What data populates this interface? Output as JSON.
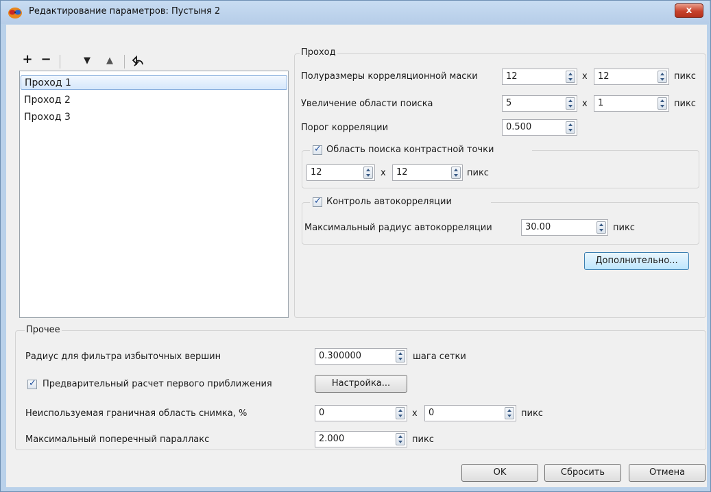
{
  "window": {
    "title": "Редактирование параметров: Пустыня 2",
    "close_label": "x"
  },
  "toolbar": {
    "add_label": "+",
    "remove_label": "−",
    "down_label": "▼",
    "up_label": "▲",
    "undo_icon": "undo-icon"
  },
  "passes": {
    "items": [
      "Проход 1",
      "Проход 2",
      "Проход 3"
    ],
    "selected_index": 0
  },
  "pass_group": {
    "title": "Проход",
    "mask_label": "Полуразмеры корреляционной маски",
    "mask_x": "12",
    "mask_sep": "x",
    "mask_y": "12",
    "mask_unit": "пикс",
    "search_label": "Увеличение области поиска",
    "search_x": "5",
    "search_sep": "x",
    "search_y": "1",
    "search_unit": "пикс",
    "threshold_label": "Порог корреляции",
    "threshold_value": "0.500",
    "contrast_group": {
      "title": "Область поиска контрастной точки",
      "checked": true,
      "x": "12",
      "sep": "x",
      "y": "12",
      "unit": "пикс"
    },
    "autocorr_group": {
      "title": "Контроль автокорреляции",
      "checked": true,
      "radius_label": "Максимальный радиус автокорреляции",
      "radius_value": "30.00",
      "unit": "пикс"
    },
    "advanced_button": "Дополнительно..."
  },
  "other_group": {
    "title": "Прочее",
    "filter_label": "Радиус для фильтра избыточных вершин",
    "filter_value": "0.300000",
    "filter_unit": "шага сетки",
    "precalc_label": "Предварительный расчет первого приближения",
    "precalc_checked": true,
    "setup_button": "Настройка...",
    "border_label": "Неиспользуемая граничная область снимка, %",
    "border_x": "0",
    "border_sep": "x",
    "border_y": "0",
    "border_unit": "пикс",
    "parallax_label": "Максимальный поперечный параллакс",
    "parallax_value": "2.000",
    "parallax_unit": "пикс"
  },
  "buttons": {
    "ok": "OK",
    "reset": "Сбросить",
    "cancel": "Отмена"
  },
  "colors": {
    "title_bar": "#b9d1ea",
    "close_button": "#c7422c",
    "selection": "#d5e7fb",
    "spin_arrow": "#3b5c86"
  }
}
